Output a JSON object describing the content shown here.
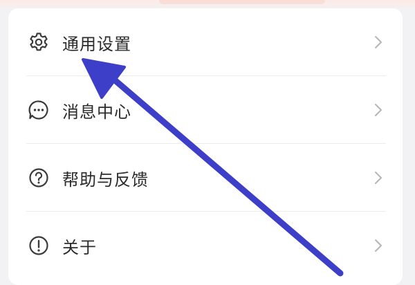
{
  "menu": {
    "items": [
      {
        "label": "通用设置",
        "icon": "gear-icon"
      },
      {
        "label": "消息中心",
        "icon": "message-icon"
      },
      {
        "label": "帮助与反馈",
        "icon": "help-icon"
      },
      {
        "label": "关于",
        "icon": "info-icon"
      }
    ]
  },
  "colors": {
    "annotation_arrow": "#3d3fc8",
    "card_background": "#ffffff",
    "page_background": "#f2f2f4",
    "text": "#2b2b2b",
    "icon": "#3a3a3a",
    "chevron": "#b5b5b5"
  }
}
